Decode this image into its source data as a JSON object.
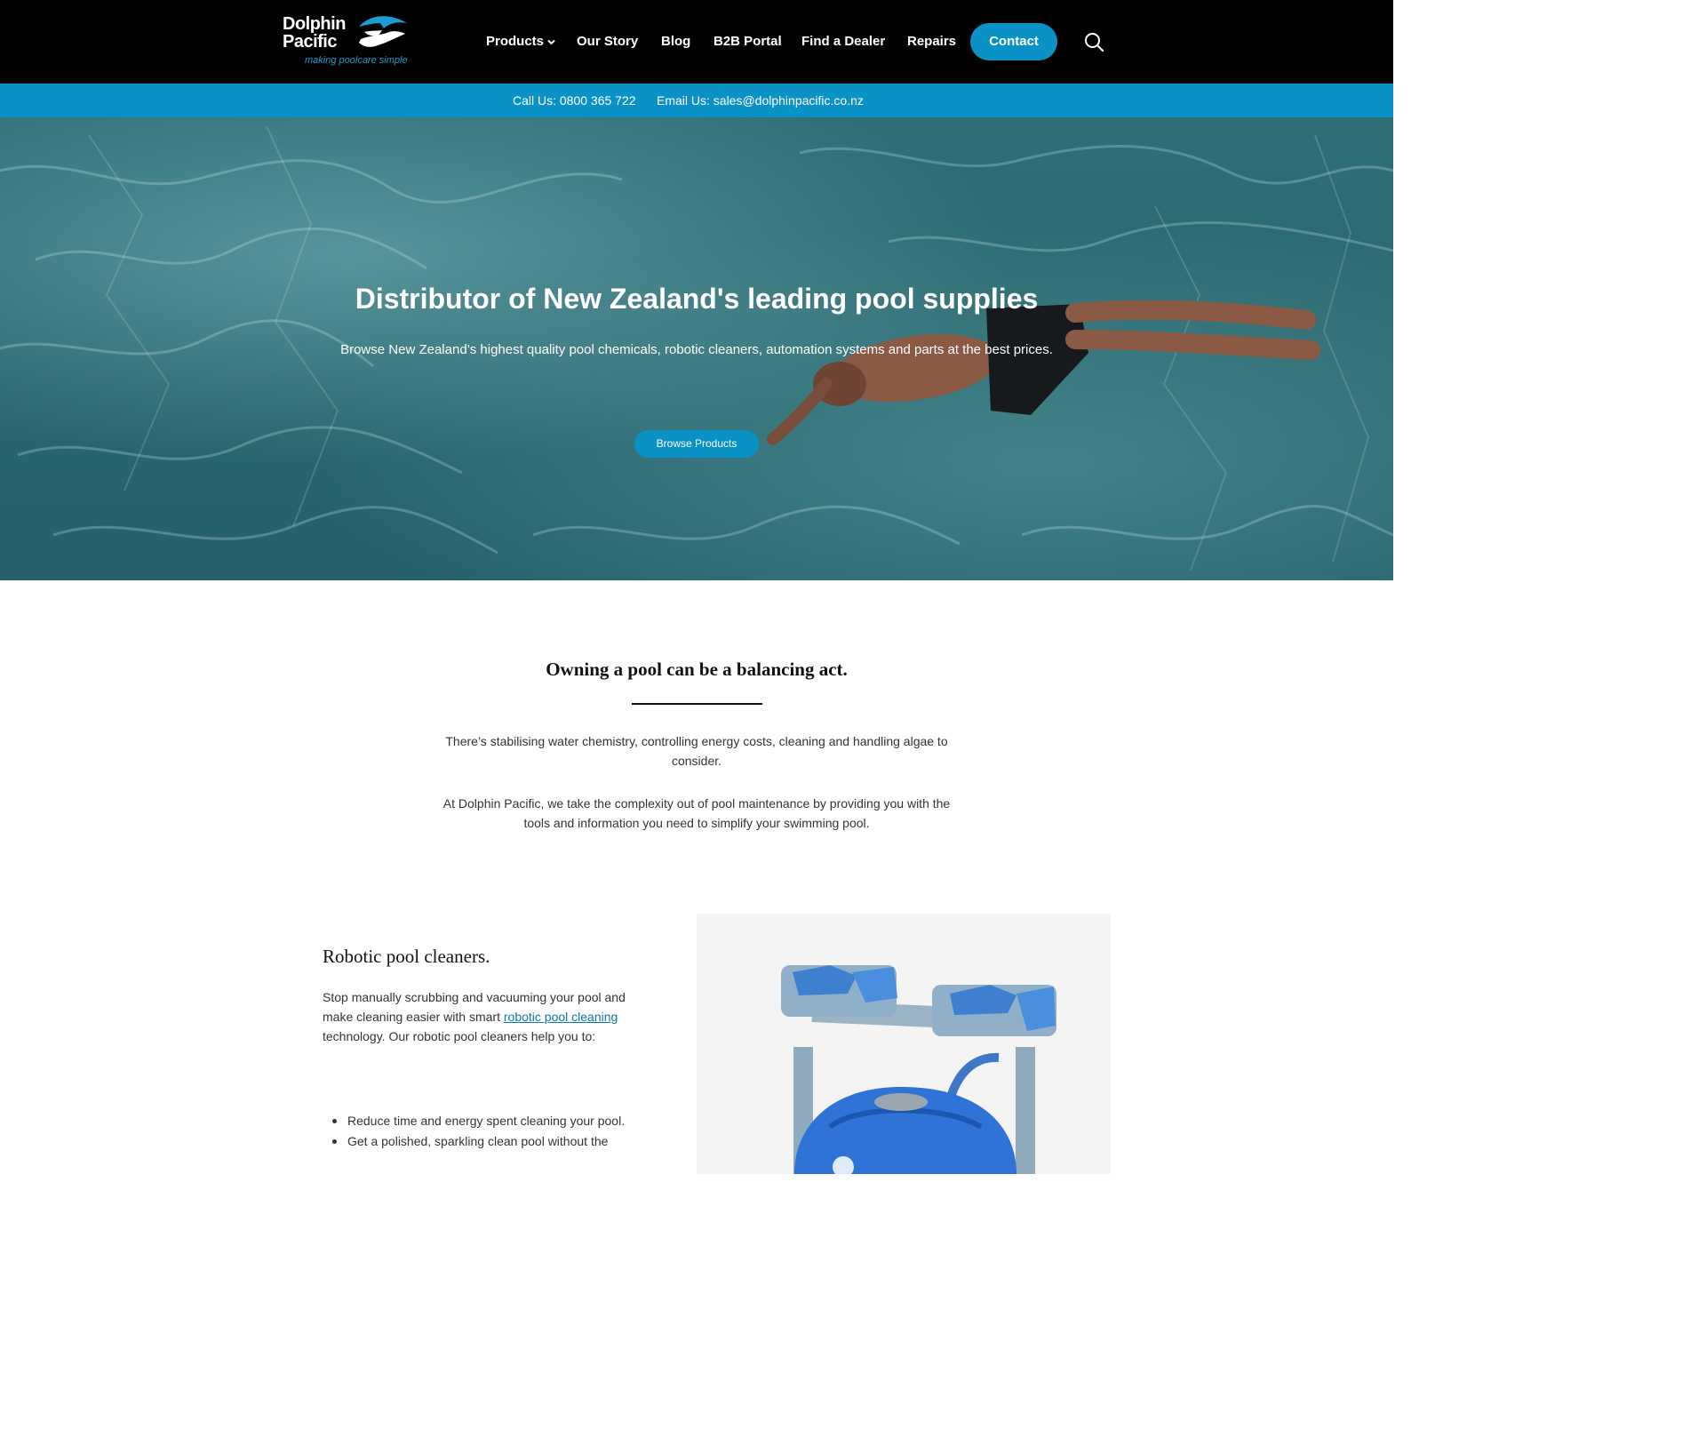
{
  "header": {
    "logo": {
      "line1": "Dolphin",
      "line2": "Pacific",
      "tagline": "making poolcare simple"
    },
    "nav": [
      {
        "label": "Products",
        "has_dropdown": true
      },
      {
        "label": "Our Story"
      },
      {
        "label": "Blog"
      },
      {
        "label": "B2B Portal"
      },
      {
        "label": "Find a Dealer"
      },
      {
        "label": "Repairs"
      }
    ],
    "contact_button": "Contact",
    "search_icon": "search-icon"
  },
  "info_bar": {
    "call": "Call Us: 0800 365 722",
    "email": "Email Us: sales@dolphinpacific.co.nz"
  },
  "hero": {
    "title": "Distributor of New Zealand's leading pool supplies",
    "subtitle": "Browse New Zealand’s highest quality pool chemicals, robotic cleaners, automation systems and parts at the best prices.",
    "button": "Browse Products"
  },
  "intro": {
    "title": "Owning a pool can be a balancing act.",
    "paragraph1": "There’s stabilising water chemistry, controlling energy costs, cleaning and handling algae to consider.",
    "paragraph2": "At Dolphin Pacific, we take the complexity out of pool maintenance by providing you with the tools and information you need to simplify your swimming pool."
  },
  "robotic": {
    "title": "Robotic pool cleaners.",
    "text_before": "Stop manually scrubbing and vacuuming your pool and make cleaning easier with smart ",
    "link": "robotic pool cleaning",
    "text_after": " technology. Our robotic pool cleaners help you to:",
    "bullets": [
      "Reduce time and energy spent cleaning your pool.",
      "Get a polished, sparkling clean pool without the"
    ]
  },
  "colors": {
    "brand_blue": "#0a92c6",
    "header_bg": "#000000",
    "panel_bg": "#f4f4f4"
  }
}
